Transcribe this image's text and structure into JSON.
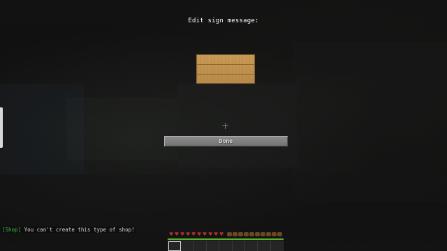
{
  "screen": {
    "title": "Edit sign message:"
  },
  "sign": {
    "lines": [
      "",
      "",
      "",
      ""
    ]
  },
  "buttons": {
    "done_label": "Done"
  },
  "chat": {
    "tag": "[Shop]",
    "message": " You can't create this type of shop!",
    "tag_color": "#3fbf4a"
  },
  "hud": {
    "hearts": 10,
    "hunger": 10,
    "hotbar_slots": 9,
    "selected_slot": 1,
    "xp_progress": 1.0
  }
}
